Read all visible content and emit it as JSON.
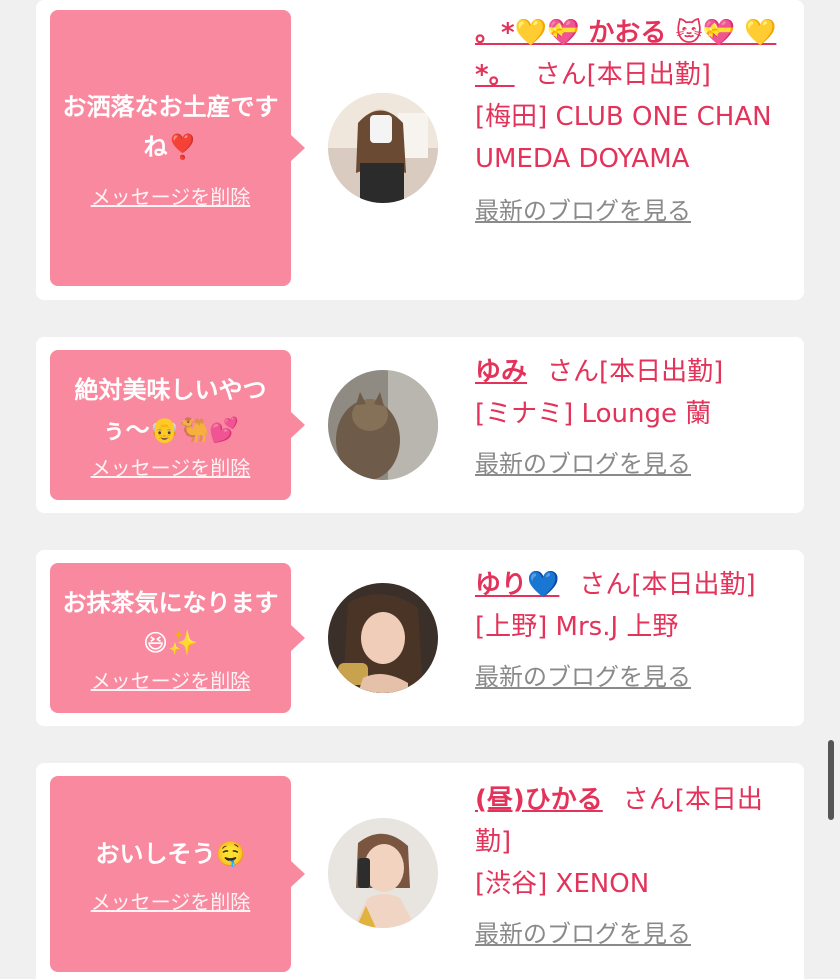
{
  "items": [
    {
      "message": "お洒落なお土産ですね❣️",
      "delete_label": "メッセージを削除",
      "name": "。*💛💝 かおる 🐱💝 💛*。",
      "suffix": "さん[本日出勤]",
      "shop": "[梅田] CLUB ONE CHAN UMEDA DOYAMA",
      "blog_label": "最新のブログを見る",
      "avatar_alt": "avatar-mirror-selfie"
    },
    {
      "message": "絶対美味しいやつぅ〜👴🐫💕",
      "delete_label": "メッセージを削除",
      "name": "ゆみ",
      "suffix": "さん[本日出勤]",
      "shop": "[ミナミ] Lounge 蘭",
      "blog_label": "最新のブログを見る",
      "avatar_alt": "avatar-cat"
    },
    {
      "message": "お抹茶気になります😆✨",
      "delete_label": "メッセージを削除",
      "name": "ゆり💙",
      "suffix": "さん[本日出勤]",
      "shop": "[上野] Mrs.J 上野",
      "blog_label": "最新のブログを見る",
      "avatar_alt": "avatar-woman-smiling"
    },
    {
      "message": "おいしそう🤤",
      "delete_label": "メッセージを削除",
      "name": "(昼)ひかる",
      "suffix": "さん[本日出勤]",
      "shop": "[渋谷] XENON",
      "blog_label": "最新のブログを見る",
      "avatar_alt": "avatar-woman-phone"
    }
  ],
  "colors": {
    "accent": "#e3335a",
    "bubble": "#f9899f",
    "background": "#f0f0f0",
    "link_gray": "#8a8a8a"
  }
}
